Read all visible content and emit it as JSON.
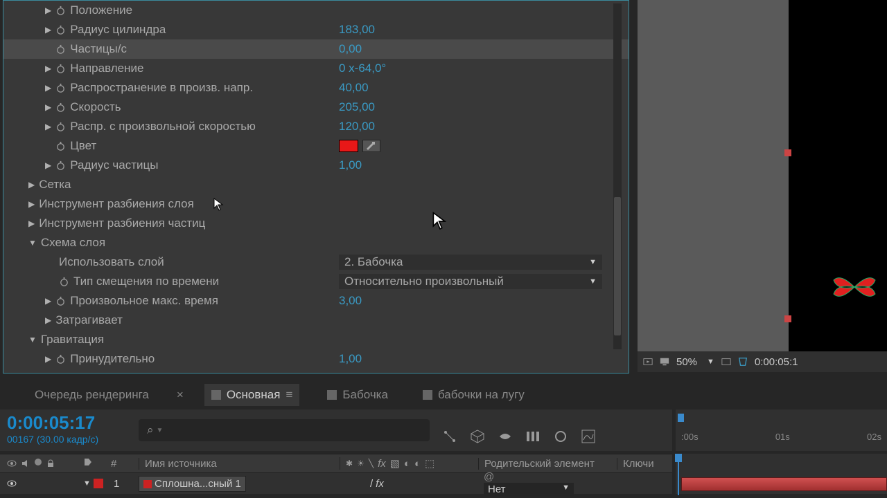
{
  "props": {
    "position_label": "Положение",
    "radius_cyl_label": "Радиус цилиндра",
    "radius_cyl_val": "183,00",
    "particles_s_label": "Частицы/с",
    "particles_s_val": "0,00",
    "direction_label": "Направление",
    "direction_val": "0 x-64,0°",
    "spread_label": "Распространение в произв. напр.",
    "spread_val": "40,00",
    "speed_label": "Скорость",
    "speed_val": "205,00",
    "randspeed_label": "Распр. с произвольной скоростью",
    "randspeed_val": "120,00",
    "color_label": "Цвет",
    "pradius_label": "Радиус частицы",
    "pradius_val": "1,00",
    "grid_label": "Сетка",
    "layer_explode_label": "Инструмент разбиения слоя",
    "particle_explode_label": "Инструмент разбиения частиц",
    "layer_map_label": "Схема слоя",
    "use_layer_label": "Использовать слой",
    "use_layer_val": "2. Бабочка",
    "time_offset_label": "Тип смещения по времени",
    "time_offset_val": "Относительно произвольный",
    "randmax_label": "Произвольное макс. время",
    "randmax_val": "3,00",
    "affects_label": "Затрагивает",
    "gravity_label": "Гравитация",
    "force_label": "Принудительно",
    "force_val": "1,00"
  },
  "viewer": {
    "zoom": "50%",
    "timecode": "0:00:05:1"
  },
  "tabs": {
    "render_queue": "Очередь рендеринга",
    "main": "Основная",
    "butterfly": "Бабочка",
    "meadow": "бабочки на лугу"
  },
  "timeline": {
    "timecode": "0:00:05:17",
    "frame_info": "00167 (30.00 кадр/с)",
    "col_sourcename": "Имя источника",
    "col_parent": "Родительский элемент",
    "col_keys": "Ключи",
    "ruler_0": ":00s",
    "ruler_1": "01s",
    "ruler_2": "02s"
  },
  "layer": {
    "num": "1",
    "name": "Сплошна...сный 1",
    "fx": "fx",
    "parent": "Нет"
  },
  "hash": "#"
}
